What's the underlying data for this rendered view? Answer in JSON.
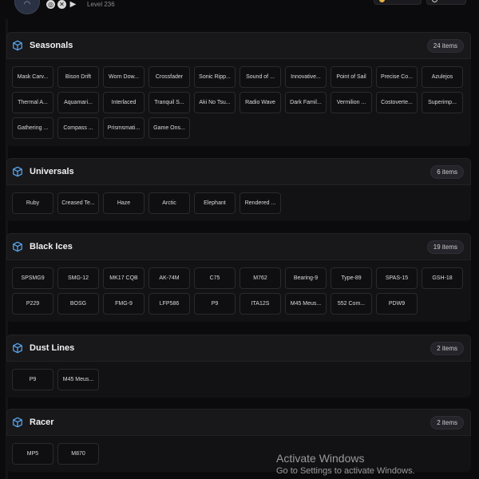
{
  "profile": {
    "level": "Level 236",
    "platforms": [
      "ubisoft-icon",
      "xbox-icon",
      "playstation-icon"
    ],
    "stat_chips": [
      "▪▪▪▪▪▪",
      "▪▪▪▪"
    ]
  },
  "sections": [
    {
      "title": "Seasonals",
      "count": "24 items",
      "items": [
        "Mask Carv...",
        "Bison Drift",
        "Worn Dow...",
        "Crossfader",
        "Sonic Ripp...",
        "Sound of ...",
        "Innovative...",
        "Point of Sail",
        "Precise Co...",
        "Azulejos",
        "Thermal A...",
        "Aquamari...",
        "Interlaced",
        "Tranquil S...",
        "Aki No Tsu...",
        "Radio Wave",
        "Dark Famil...",
        "Vermilion ...",
        "Costoverte...",
        "Superimp...",
        "Gathering ...",
        "Compass ...",
        "Prismsmati...",
        "Game Ons..."
      ]
    },
    {
      "title": "Universals",
      "count": "6 items",
      "items": [
        "Ruby",
        "Creased Te...",
        "Haze",
        "Arctic",
        "Elephant",
        "Rendered ..."
      ]
    },
    {
      "title": "Black Ices",
      "count": "19 items",
      "items": [
        "SPSMG9",
        "SMG-12",
        "MK17 CQB",
        "AK-74M",
        "C75",
        "M762",
        "Bearing-9",
        "Type-89",
        "SPAS-15",
        "GSH-18",
        "P229",
        "BOSG",
        "FMG-9",
        "LFP586",
        "P9",
        "ITA12S",
        "M45 Meus...",
        "552 Com...",
        "PDW9"
      ]
    },
    {
      "title": "Dust Lines",
      "count": "2 items",
      "items": [
        "P9",
        "M45 Meus..."
      ]
    },
    {
      "title": "Racer",
      "count": "2 items",
      "items": [
        "MP5",
        "M870"
      ]
    }
  ],
  "watermark": {
    "title": "Activate Windows",
    "subtitle": "Go to Settings to activate Windows."
  }
}
